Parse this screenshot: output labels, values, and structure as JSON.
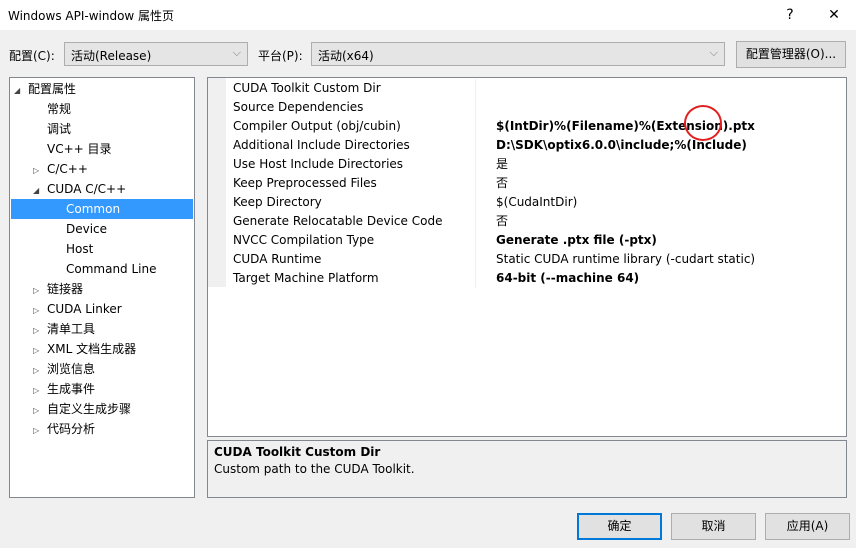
{
  "window": {
    "title": "Windows API-window 属性页",
    "help": "?",
    "close": "✕"
  },
  "config": {
    "config_label": "配置(C):",
    "config_value": "活动(Release)",
    "platform_label": "平台(P):",
    "platform_value": "活动(x64)",
    "manager_button": "配置管理器(O)..."
  },
  "tree": [
    {
      "label": "配置属性",
      "level": 0,
      "expanded": true
    },
    {
      "label": "常规",
      "level": 1
    },
    {
      "label": "调试",
      "level": 1
    },
    {
      "label": "VC++ 目录",
      "level": 1
    },
    {
      "label": "C/C++",
      "level": 1,
      "collapsed": true
    },
    {
      "label": "CUDA C/C++",
      "level": 1,
      "expanded": true
    },
    {
      "label": "Common",
      "level": 2,
      "selected": true
    },
    {
      "label": "Device",
      "level": 2
    },
    {
      "label": "Host",
      "level": 2
    },
    {
      "label": "Command Line",
      "level": 2
    },
    {
      "label": "链接器",
      "level": 1,
      "collapsed": true
    },
    {
      "label": "CUDA Linker",
      "level": 1,
      "collapsed": true
    },
    {
      "label": "清单工具",
      "level": 1,
      "collapsed": true
    },
    {
      "label": "XML 文档生成器",
      "level": 1,
      "collapsed": true
    },
    {
      "label": "浏览信息",
      "level": 1,
      "collapsed": true
    },
    {
      "label": "生成事件",
      "level": 1,
      "collapsed": true
    },
    {
      "label": "自定义生成步骤",
      "level": 1,
      "collapsed": true
    },
    {
      "label": "代码分析",
      "level": 1,
      "collapsed": true
    }
  ],
  "properties": [
    {
      "name": "CUDA Toolkit Custom Dir",
      "value": "",
      "bold": false
    },
    {
      "name": "Source Dependencies",
      "value": "",
      "bold": false
    },
    {
      "name": "Compiler Output (obj/cubin)",
      "value": "$(IntDir)%(Filename)%(Extension).ptx",
      "bold": true
    },
    {
      "name": "Additional Include Directories",
      "value": "D:\\SDK\\optix6.0.0\\include;%(Include)",
      "bold": true
    },
    {
      "name": "Use Host Include Directories",
      "value": "是",
      "bold": false
    },
    {
      "name": "Keep Preprocessed Files",
      "value": "否",
      "bold": false
    },
    {
      "name": "Keep Directory",
      "value": "$(CudaIntDir)",
      "bold": false
    },
    {
      "name": "Generate Relocatable Device Code",
      "value": "否",
      "bold": false
    },
    {
      "name": "NVCC Compilation Type",
      "value": "Generate .ptx file (-ptx)",
      "bold": true
    },
    {
      "name": "CUDA Runtime",
      "value": "Static CUDA runtime library (-cudart static)",
      "bold": false
    },
    {
      "name": "Target Machine Platform",
      "value": "64-bit (--machine 64)",
      "bold": true
    }
  ],
  "description": {
    "title": "CUDA Toolkit Custom Dir",
    "text": "Custom path to the CUDA Toolkit."
  },
  "buttons": {
    "ok": "确定",
    "cancel": "取消",
    "apply": "应用(A)"
  },
  "annotation_color": "#e02020"
}
